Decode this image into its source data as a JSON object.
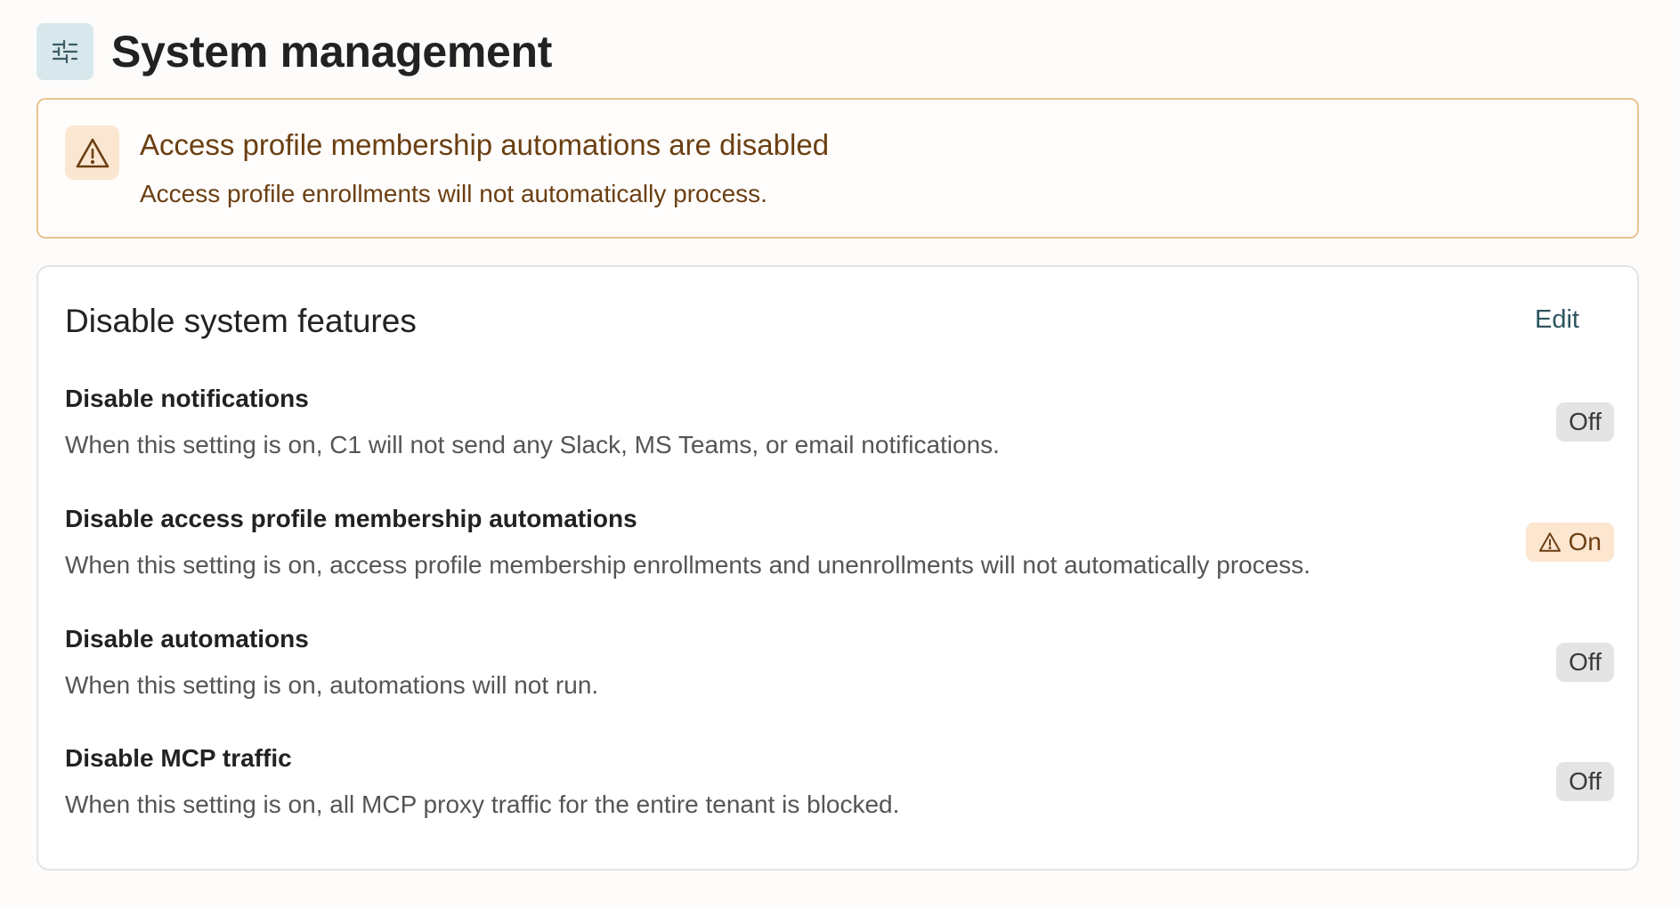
{
  "header": {
    "title": "System management",
    "icon": "sliders-icon"
  },
  "alert": {
    "icon": "warning-icon",
    "title": "Access profile membership automations are disabled",
    "description": "Access profile enrollments will not automatically process.",
    "color": "#6b3f12"
  },
  "card": {
    "title": "Disable system features",
    "edit_label": "Edit",
    "settings": [
      {
        "title": "Disable notifications",
        "description": "When this setting is on, C1 will not send any Slack, MS Teams, or email notifications.",
        "status": "Off"
      },
      {
        "title": "Disable access profile membership automations",
        "description": "When this setting is on, access profile membership enrollments and unenrollments will not automatically process.",
        "status": "On"
      },
      {
        "title": "Disable automations",
        "description": "When this setting is on, automations will not run.",
        "status": "Off"
      },
      {
        "title": "Disable MCP traffic",
        "description": "When this setting is on, all MCP proxy traffic for the entire tenant is blocked.",
        "status": "Off"
      }
    ]
  }
}
